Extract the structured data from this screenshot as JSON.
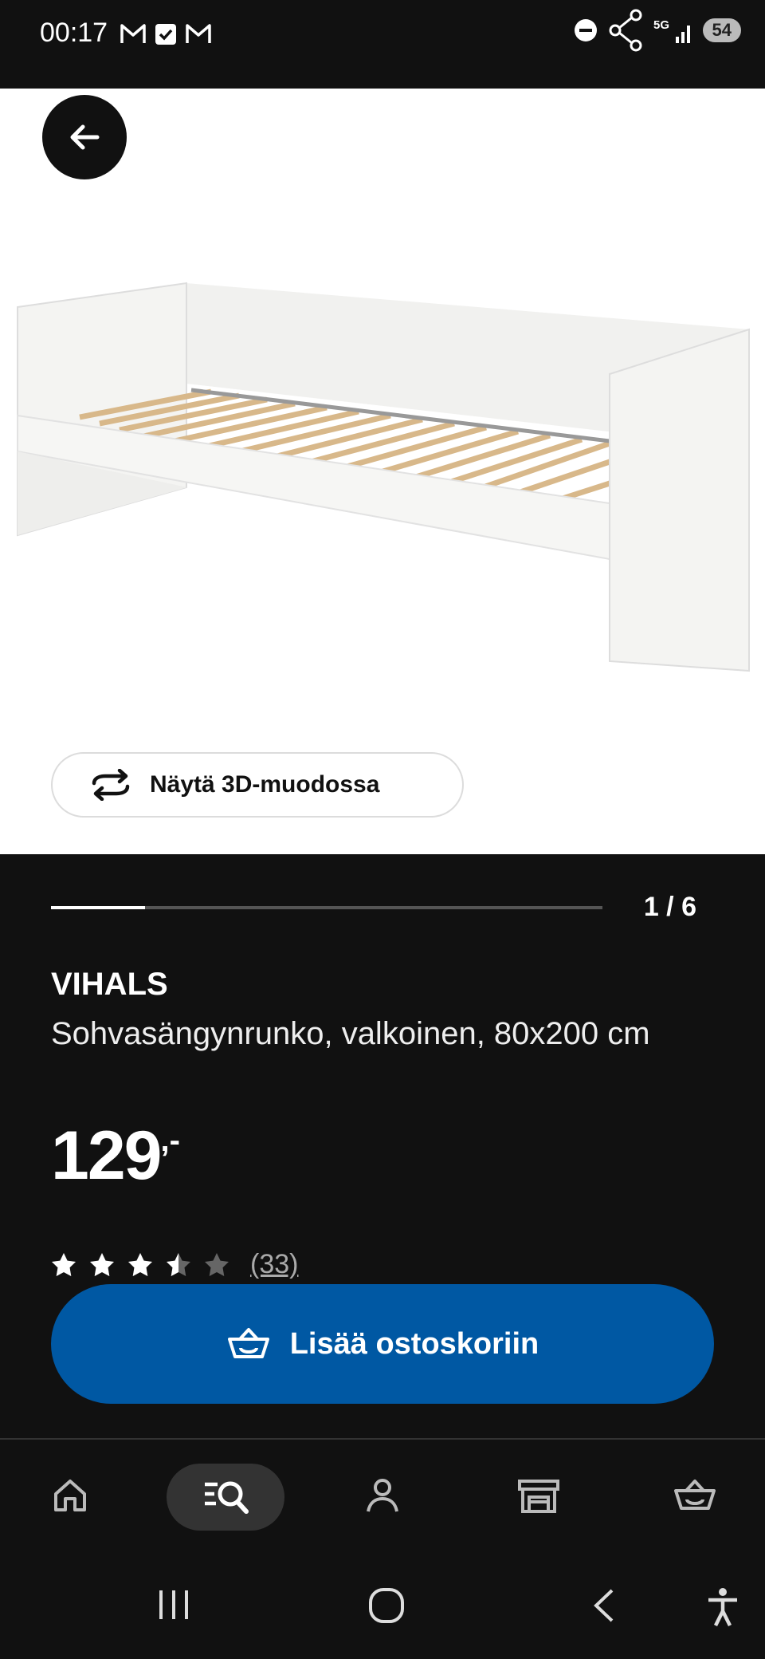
{
  "status_bar": {
    "time": "00:17",
    "battery": "54"
  },
  "product": {
    "view3d_label": "Näytä 3D-muodossa",
    "image_counter": "1 / 6",
    "image_progress": 0.17,
    "brand": "VIHALS",
    "description": "Sohvasängynrunko, valkoinen, 80x200 cm",
    "price_integer": "129",
    "price_decimal": ",-",
    "rating": 3.5,
    "rating_max": 5,
    "review_count": "(33)"
  },
  "actions": {
    "add_to_cart": "Lisää ostoskoriin"
  },
  "bottom_nav": {
    "items": [
      "home-icon",
      "search-list-icon",
      "profile-icon",
      "store-icon",
      "basket-icon"
    ],
    "active": "search-list-icon"
  },
  "colors": {
    "primary": "#0058a3",
    "background": "#111111",
    "text": "#ffffff"
  }
}
